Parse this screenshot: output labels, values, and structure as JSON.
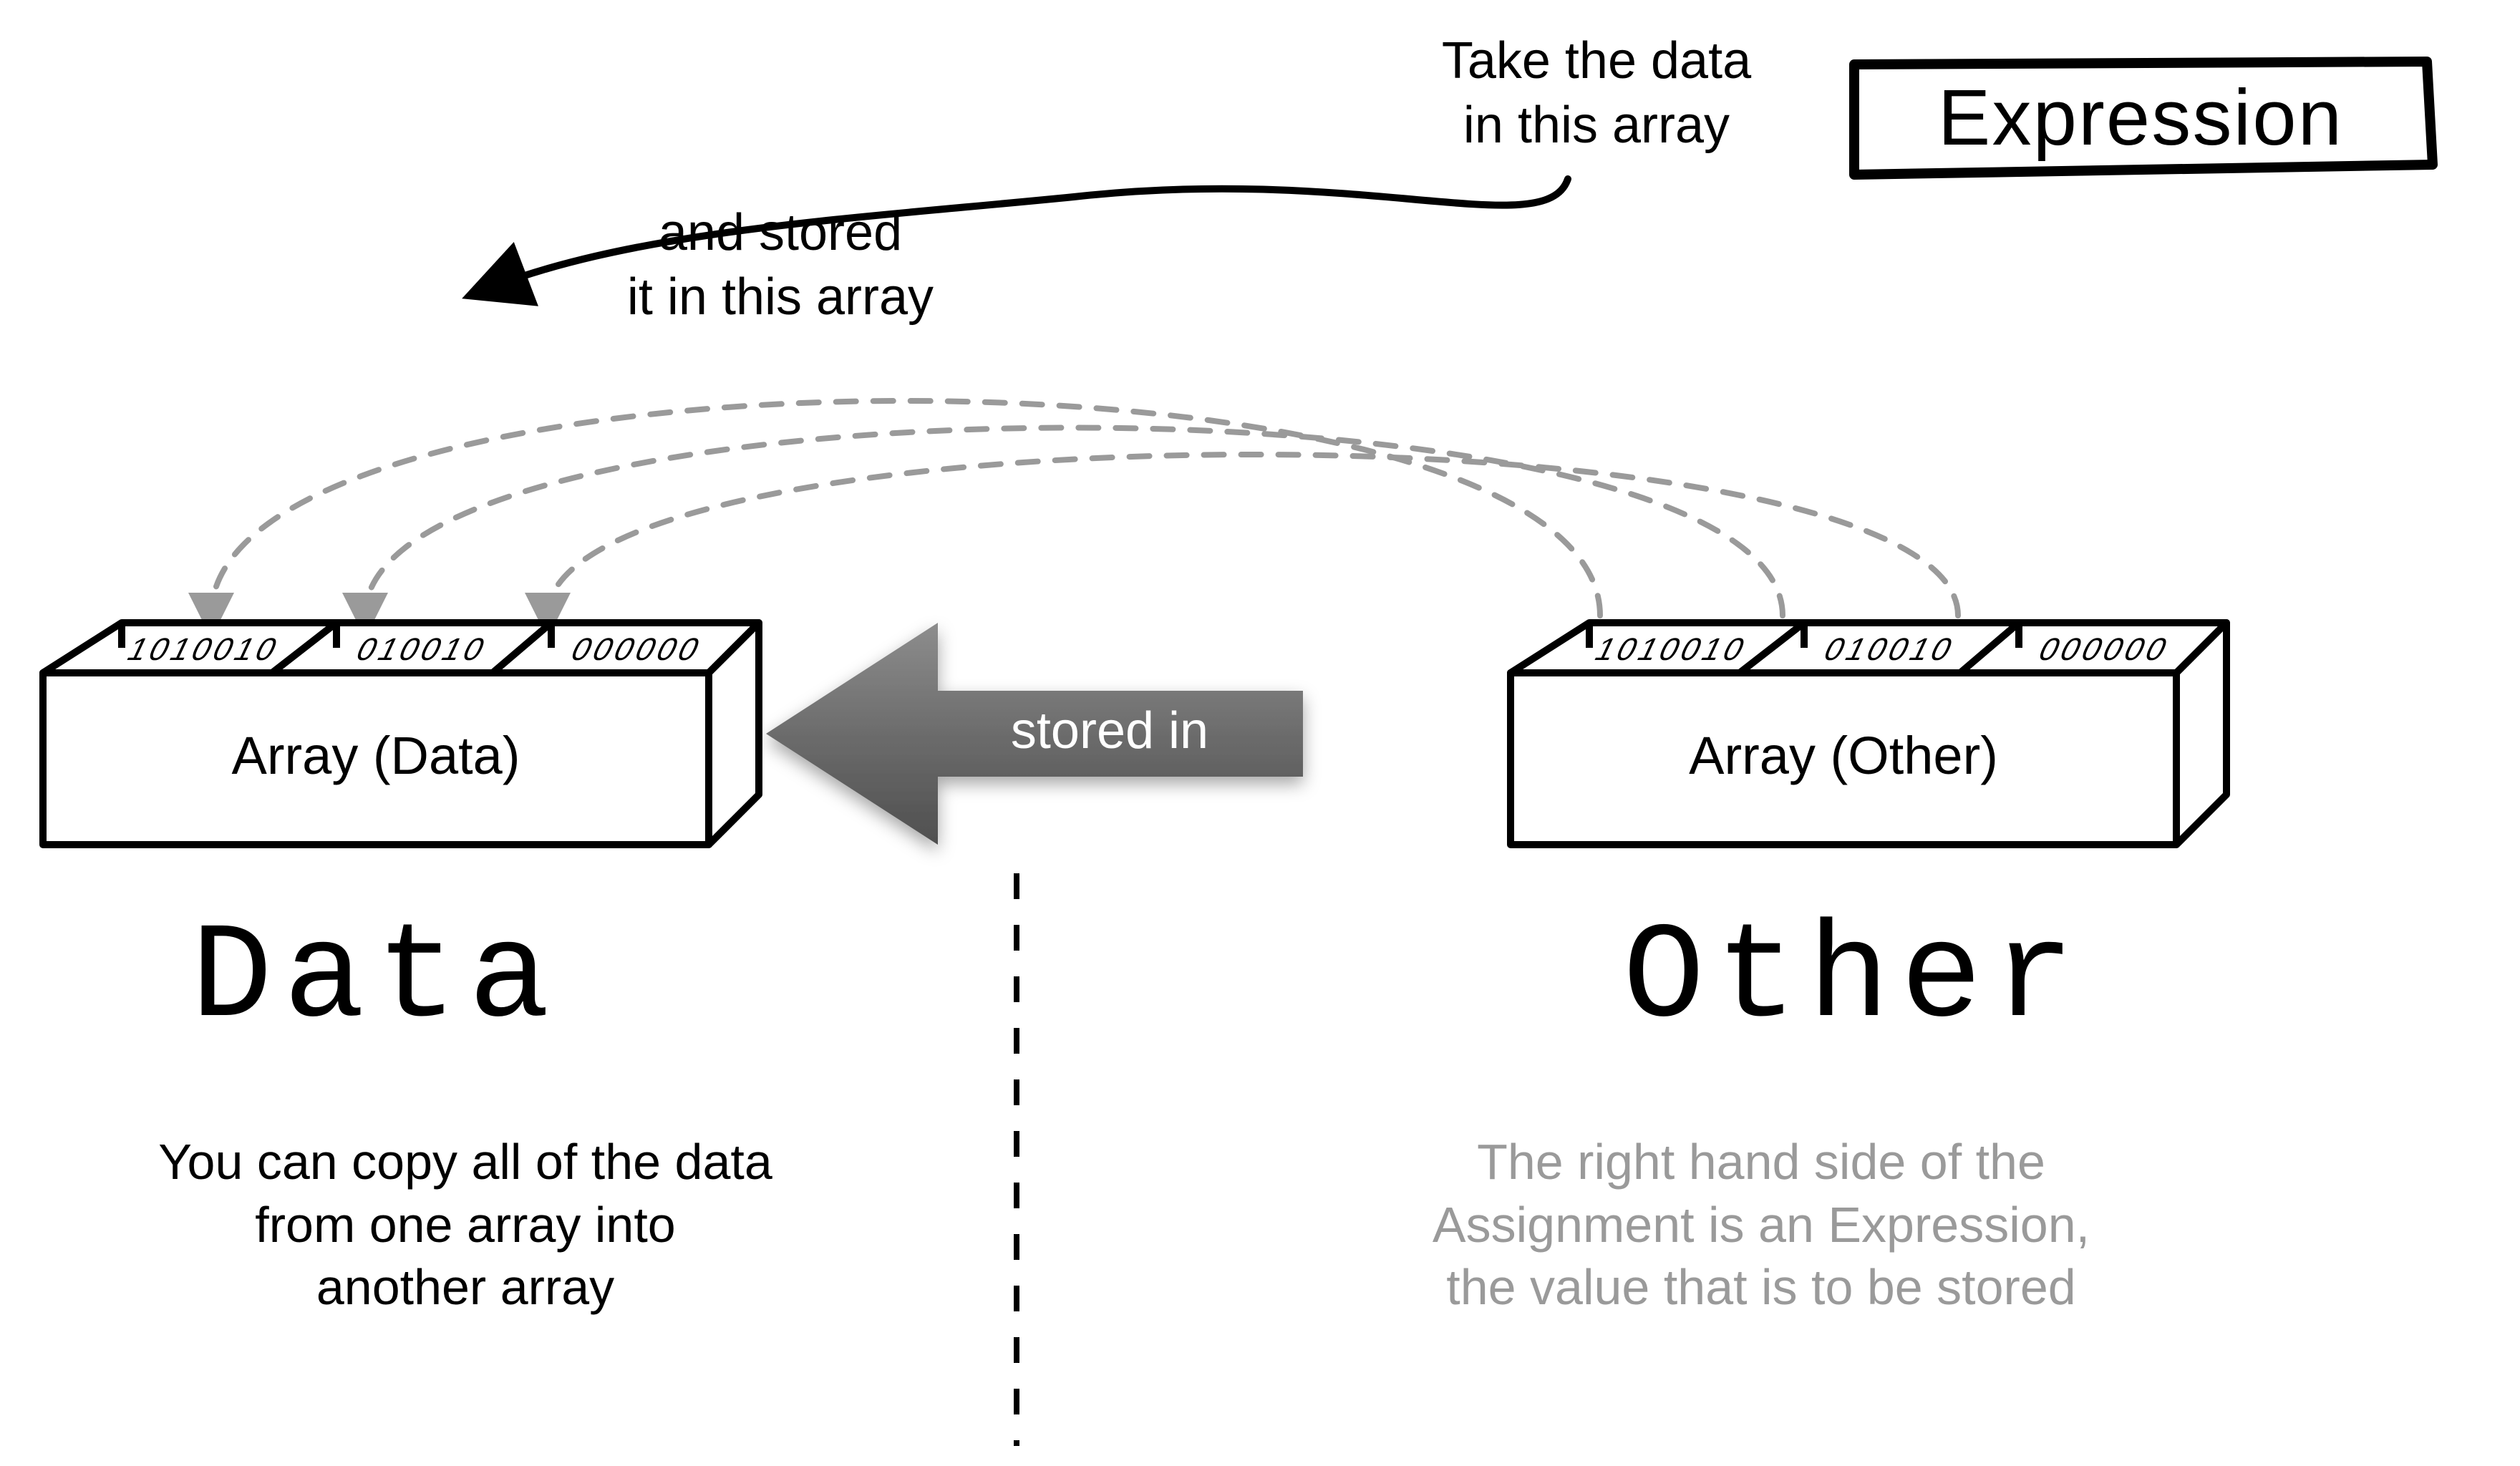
{
  "annotations": {
    "take_data": "Take the data\nin this array",
    "and_stored": "and stored\nit in this array",
    "left_caption": "You can copy all of the data\nfrom one array into\nanother array",
    "right_caption": "The right hand side of the\nAssignment is an Expression,\nthe value that is to be stored"
  },
  "boxes": {
    "left_label_inside": "Array (Data)",
    "right_label_inside": "Array (Other)",
    "cell_bits_a": "1010010",
    "cell_bits_b": "010010",
    "cell_bits_c": "000000"
  },
  "titles": {
    "left_big": "Data",
    "right_big": "Other",
    "expression_badge": "Expression"
  },
  "arrow": {
    "center_label": "stored in"
  }
}
